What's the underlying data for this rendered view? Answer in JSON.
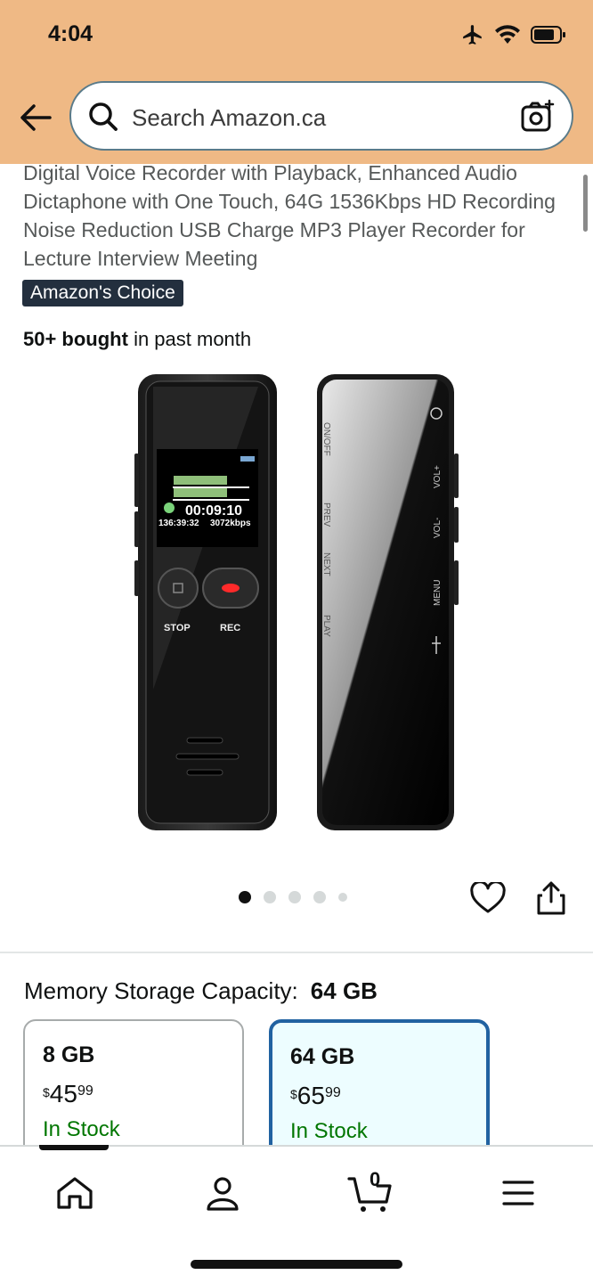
{
  "status_bar": {
    "time": "4:04",
    "icons": [
      "airplane-icon",
      "wifi-icon",
      "battery-icon"
    ]
  },
  "header": {
    "back_icon": "back-arrow-icon",
    "search_placeholder": "Search Amazon.ca",
    "camera_icon": "camera-search-icon",
    "background_color": "#efb985"
  },
  "product": {
    "title": "Digital Voice Recorder with Playback, Enhanced Audio Dictaphone with One Touch, 64G 1536Kbps HD Recording Noise Reduction USB Charge MP3 Player Recorder for Lecture Interview Meeting",
    "badge": "Amazon's Choice",
    "bought_bold": "50+ bought",
    "bought_rest": " in past month"
  },
  "device_screen": {
    "time": "00:09:10",
    "clock": "136:39:32",
    "bitrate": "3072kbps",
    "stop_label": "STOP",
    "rec_label": "REC",
    "side_labels_left": [
      "ON/OFF",
      "PREV",
      "NEXT",
      "PLAY"
    ],
    "side_labels_right": [
      "VOL+",
      "VOL-",
      "MENU"
    ]
  },
  "carousel": {
    "dot_count": 5,
    "active_index": 0
  },
  "capacity": {
    "label": "Memory Storage Capacity:",
    "selected_value": "64 GB",
    "options": [
      {
        "size": "8 GB",
        "currency": "$",
        "dollars": "45",
        "cents": "99",
        "stock": "In Stock",
        "selected": false
      },
      {
        "size": "64 GB",
        "currency": "$",
        "dollars": "65",
        "cents": "99",
        "stock": "In Stock",
        "selected": true
      }
    ]
  },
  "bottom_nav": {
    "items": [
      "home-icon",
      "account-icon",
      "cart-icon",
      "menu-icon"
    ],
    "cart_count": "0"
  },
  "colors": {
    "badge": "#232f3e",
    "stock": "#007600",
    "selected_border": "#2162a1",
    "selected_bg": "#edfdff"
  }
}
